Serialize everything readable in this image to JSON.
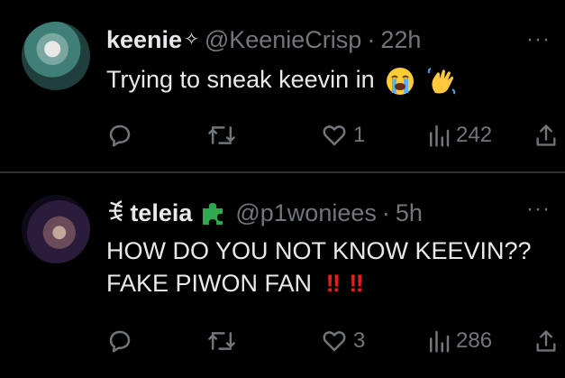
{
  "tweets": [
    {
      "display_name": "keenie",
      "name_symbol": "✧",
      "handle": "@KeenieCrisp",
      "separator": "·",
      "time": "22h",
      "text": "Trying to sneak keevin in",
      "text_emojis": [
        "loudly-crying-face-emoji",
        "waving-hand-emoji"
      ],
      "more": "···",
      "likes": "1",
      "views": "242"
    },
    {
      "name_prefix": "ꉂ",
      "display_name": "teleia",
      "name_emoji": "puzzle-piece-emoji",
      "handle": "@p1woniees",
      "separator": "·",
      "time": "5h",
      "text_line1": "HOW DO YOU NOT KNOW KEEVIN??",
      "text_line2": "FAKE PIWON FAN",
      "text_bangs": "‼ ‼",
      "more": "···",
      "likes": "3",
      "views": "286"
    }
  ],
  "colors": {
    "background": "#000000",
    "primary_text": "#e7e9ea",
    "secondary_text": "#71767b",
    "divider": "#2f3336",
    "exclamation": "#e02020",
    "puzzle": "#2fa84f"
  }
}
